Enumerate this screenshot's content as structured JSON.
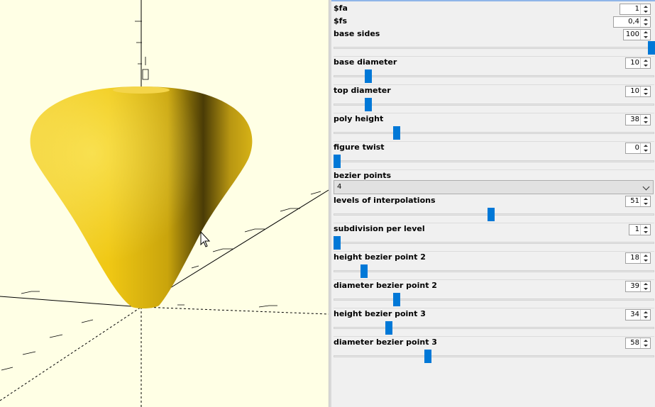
{
  "viewport": {
    "background": "#ffffe5",
    "model_color": "#e8c814"
  },
  "params": [
    {
      "label": "$fa",
      "value": "1",
      "slider": null
    },
    {
      "label": "$fs",
      "value": "0,4",
      "slider": null
    },
    {
      "label": "base sides",
      "value": "100",
      "slider": 1.0
    },
    {
      "label": "base diameter",
      "value": "10",
      "slider": 0.1
    },
    {
      "label": "top diameter",
      "value": "10",
      "slider": 0.1
    },
    {
      "label": "poly height",
      "value": "38",
      "slider": 0.19
    },
    {
      "label": "figure twist",
      "value": "0",
      "slider": 0.0
    },
    {
      "label": "bezier points",
      "value": "4",
      "type": "dropdown"
    },
    {
      "label": "levels of interpolations",
      "value": "51",
      "slider": 0.49
    },
    {
      "label": "subdivision per level",
      "value": "1",
      "slider": 0.0
    },
    {
      "label": "height bezier point 2",
      "value": "18",
      "slider": 0.085
    },
    {
      "label": "diameter bezier point 2",
      "value": "39",
      "slider": 0.19
    },
    {
      "label": "height bezier point 3",
      "value": "34",
      "slider": 0.165
    },
    {
      "label": "diameter bezier point 3",
      "value": "58",
      "slider": 0.29
    }
  ]
}
